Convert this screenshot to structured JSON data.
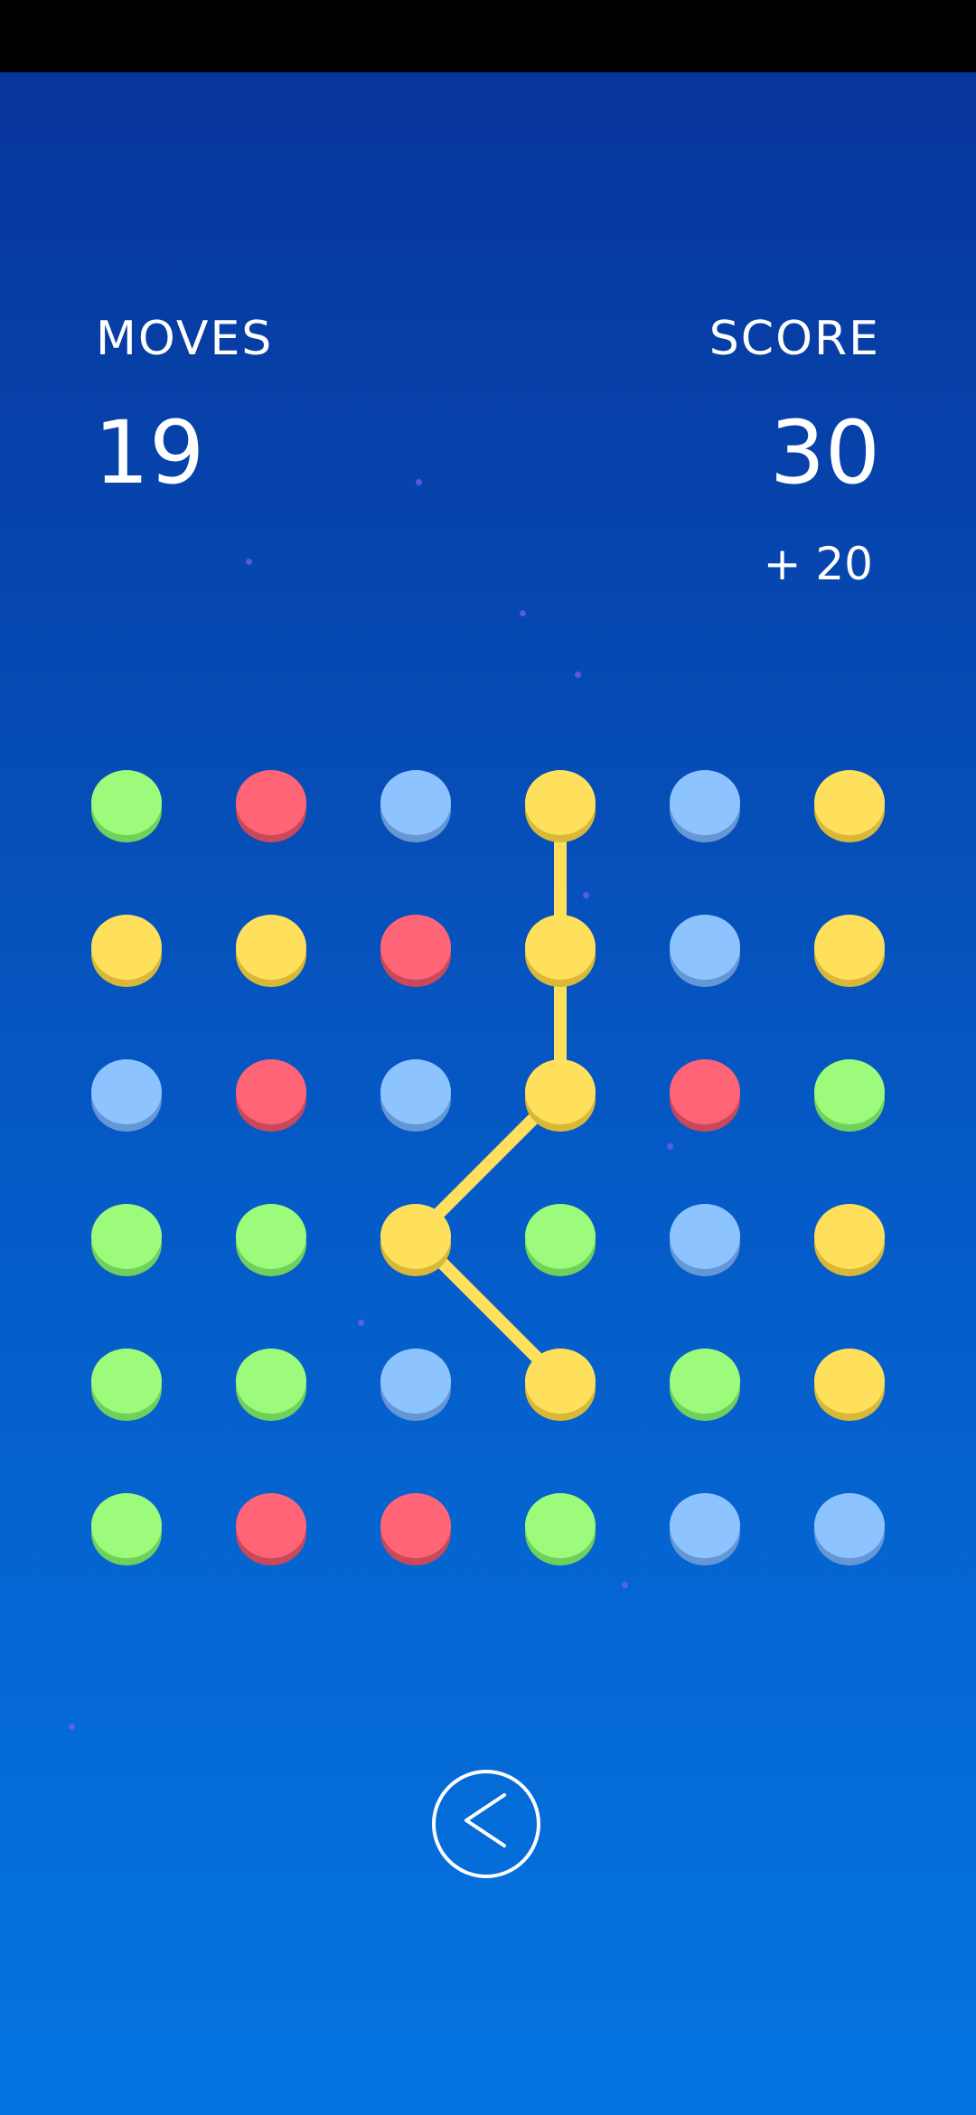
{
  "hud": {
    "moves_label": "MOVES",
    "moves_value": "19",
    "score_label": "SCORE",
    "score_value": "30",
    "score_bonus": "+ 20"
  },
  "colors": {
    "green": "#9dfb7c",
    "red": "#ff6576",
    "blue": "#8dc3ff",
    "yellow": "#ffe05c",
    "line": "#ffe05c"
  },
  "board": {
    "rows": 6,
    "cols": 6,
    "grid": [
      [
        "green",
        "red",
        "blue",
        "yellow",
        "blue",
        "yellow"
      ],
      [
        "yellow",
        "yellow",
        "red",
        "yellow",
        "blue",
        "yellow"
      ],
      [
        "blue",
        "red",
        "blue",
        "yellow",
        "red",
        "green"
      ],
      [
        "green",
        "green",
        "yellow",
        "green",
        "blue",
        "yellow"
      ],
      [
        "green",
        "green",
        "blue",
        "yellow",
        "green",
        "yellow"
      ],
      [
        "green",
        "red",
        "red",
        "green",
        "blue",
        "blue"
      ]
    ],
    "selected_path": [
      [
        0,
        3
      ],
      [
        1,
        3
      ],
      [
        2,
        3
      ],
      [
        3,
        2
      ],
      [
        4,
        3
      ]
    ]
  },
  "controls": {
    "back_icon": "chevron-left-icon"
  }
}
